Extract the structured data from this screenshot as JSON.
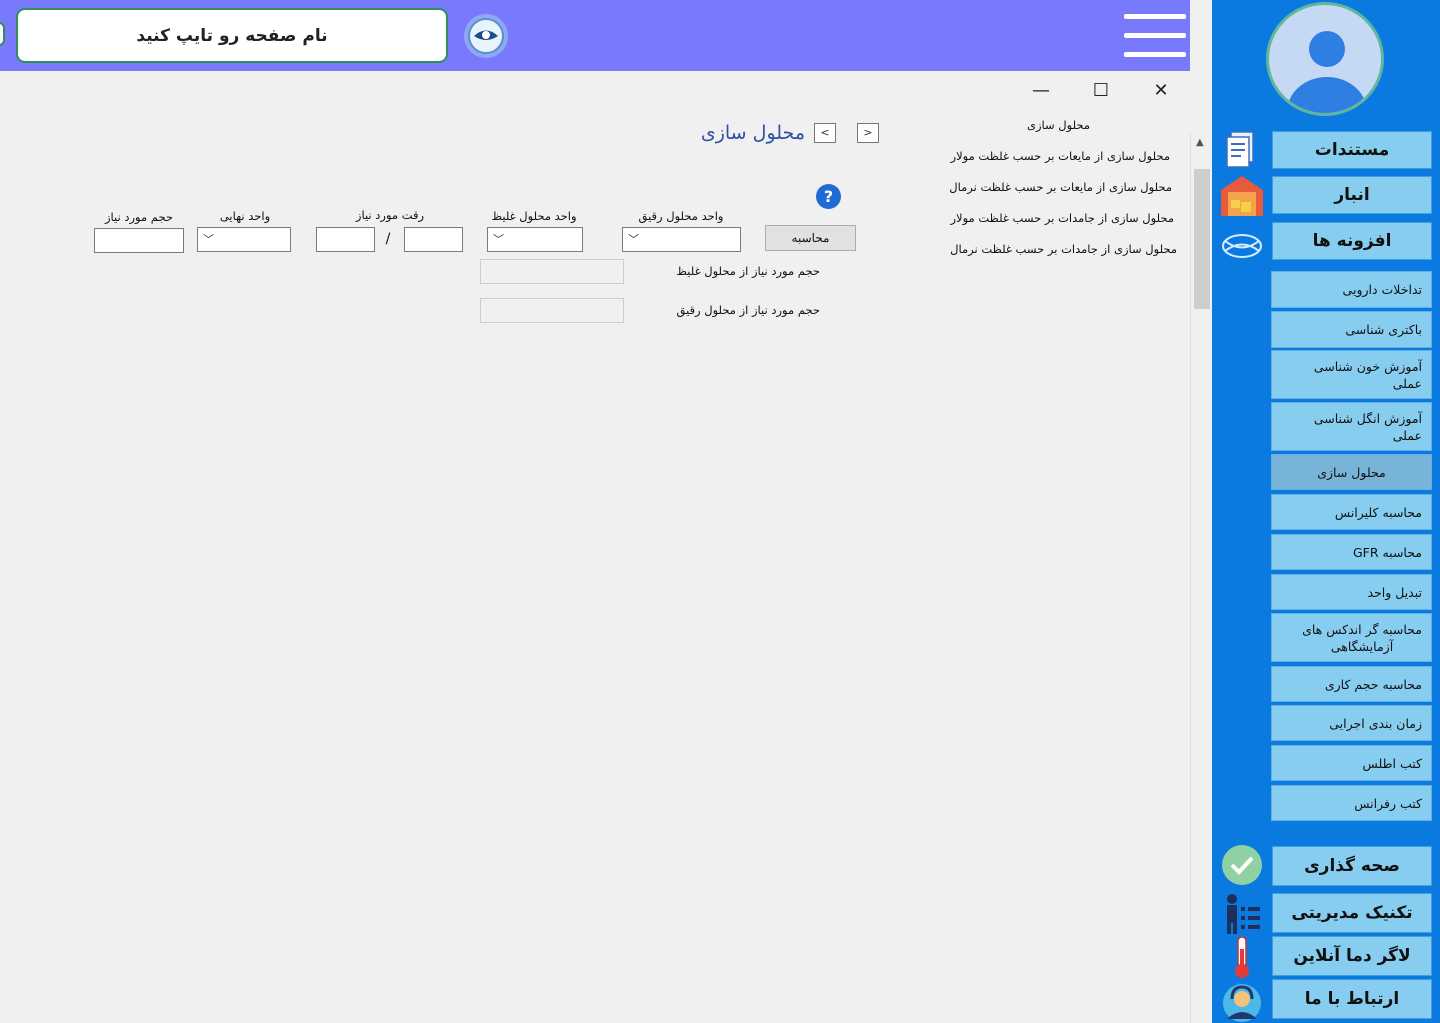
{
  "header": {
    "search_placeholder": "نام صفحه رو تایپ کنید"
  },
  "window": {
    "minimize_label": "—",
    "maximize_label": "☐",
    "close_label": "✕"
  },
  "nav_list": [
    "محلول سازی",
    "محلول سازی از مایعات بر حسب غلظت مولار",
    "محلول سازی از مایعات بر حسب غلظت نرمال",
    "محلول سازی از جامدات بر حسب غلظت مولار",
    "محلول سازی از جامدات بر حسب غلظت نرمال"
  ],
  "page": {
    "title": "محلول سازی",
    "back_arrow": "<",
    "forward_arrow": ">"
  },
  "form": {
    "calc_button": "محاسبه",
    "help": "?",
    "label_dilute_unit": "واحد محلول رقیق",
    "label_conc_unit": "واحد محلول غلیظ",
    "label_dilution": "رقت مورد نیاز",
    "label_final_unit": "واحد نهایی",
    "label_volume": "حجم مورد نیاز",
    "divider": "/",
    "label_vol_conc": "حجم مورد نیاز از محلول غلیظ",
    "label_vol_dilute": "حجم مورد نیاز از محلول رقیق"
  },
  "sidebar": {
    "main_buttons": [
      "مستندات",
      "انبار",
      "افزونه ها"
    ],
    "sub_buttons": [
      "تداخلات دارویی",
      "باکتری شناسی",
      "آموزش خون شناسی عملی",
      "آموزش انگل شناسی عملی",
      "محلول سازی",
      "محاسبه کلیرانس",
      "محاسبه GFR",
      "تبدیل واحد",
      "محاسبه گر اندکس های آزمایشگاهی",
      "محاسبه حجم کاری",
      "زمان بندی اجرایی",
      "کتب اطلس",
      "کتب رفرانس"
    ],
    "bottom_buttons": [
      "صحه گذاری",
      "تکنیک مدیریتی",
      "لاگر دما آنلاین",
      "ارتباط با ما"
    ]
  },
  "colors": {
    "header_bg": "#7979fb",
    "sidebar_bg": "#0b7ae0",
    "sidebar_button": "#87cdf0",
    "active_button": "#78b3d8",
    "title": "#2f4fa8"
  }
}
